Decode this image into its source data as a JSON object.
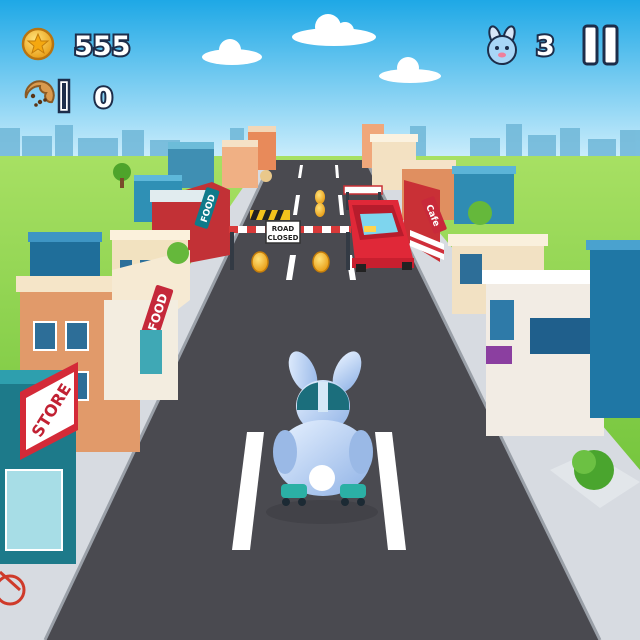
{
  "hud": {
    "coins": "555",
    "cookies": "0",
    "lives": "3",
    "coin_icon": "star-coin-icon",
    "cookie_icon": "cookie-icon",
    "lives_icon": "bunny-face-icon",
    "pause_icon": "pause-icon"
  },
  "signs": {
    "road_closed_line1": "ROAD",
    "road_closed_line2": "CLOSED",
    "store": "STORE",
    "food_left_near": "FOOD",
    "food_left_far": "FOOD",
    "cafe_right": "Cafe"
  },
  "colors": {
    "sky_top": "#1ea8e6",
    "sky_bottom": "#cdeefc",
    "grass": "#7cd13a",
    "road": "#4a4a50",
    "sidewalk": "#d8dce2",
    "hud_stroke": "#1d2d4a",
    "coin": "#f6b51e",
    "player": "#b9d4f4",
    "car": "#e0283a"
  }
}
